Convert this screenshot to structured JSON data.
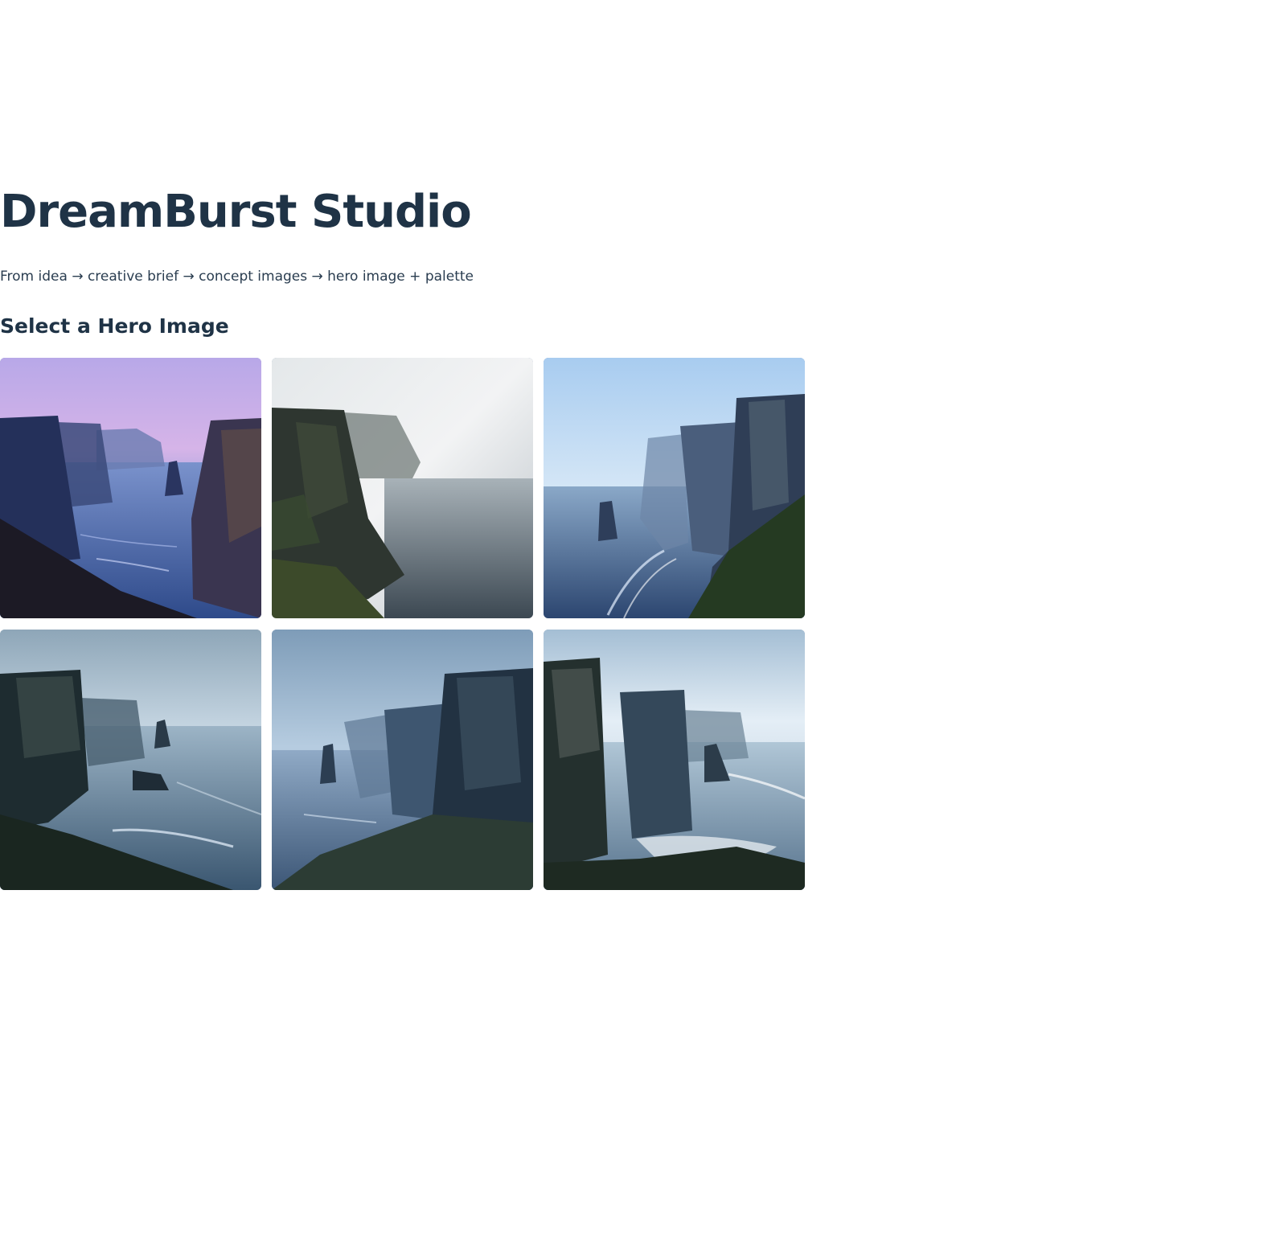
{
  "app": {
    "title": "DreamBurst Studio",
    "subtitle": "From idea → creative brief → concept images → hero image + palette"
  },
  "gallery": {
    "heading": "Select a Hero Image",
    "images": [
      {
        "scene": "sea-cliffs-twilight-violet-sky"
      },
      {
        "scene": "sea-cliffs-dense-fog-calm-sea"
      },
      {
        "scene": "sea-cliffs-pale-blue-mist-surf"
      },
      {
        "scene": "sea-cliffs-misty-sea-stack-waves"
      },
      {
        "scene": "sea-cliffs-fog-sea-stack-grass"
      },
      {
        "scene": "sea-cliffs-bright-haze-white-surf"
      }
    ]
  },
  "colors": {
    "text": "#1f3346",
    "background": "#ffffff"
  }
}
